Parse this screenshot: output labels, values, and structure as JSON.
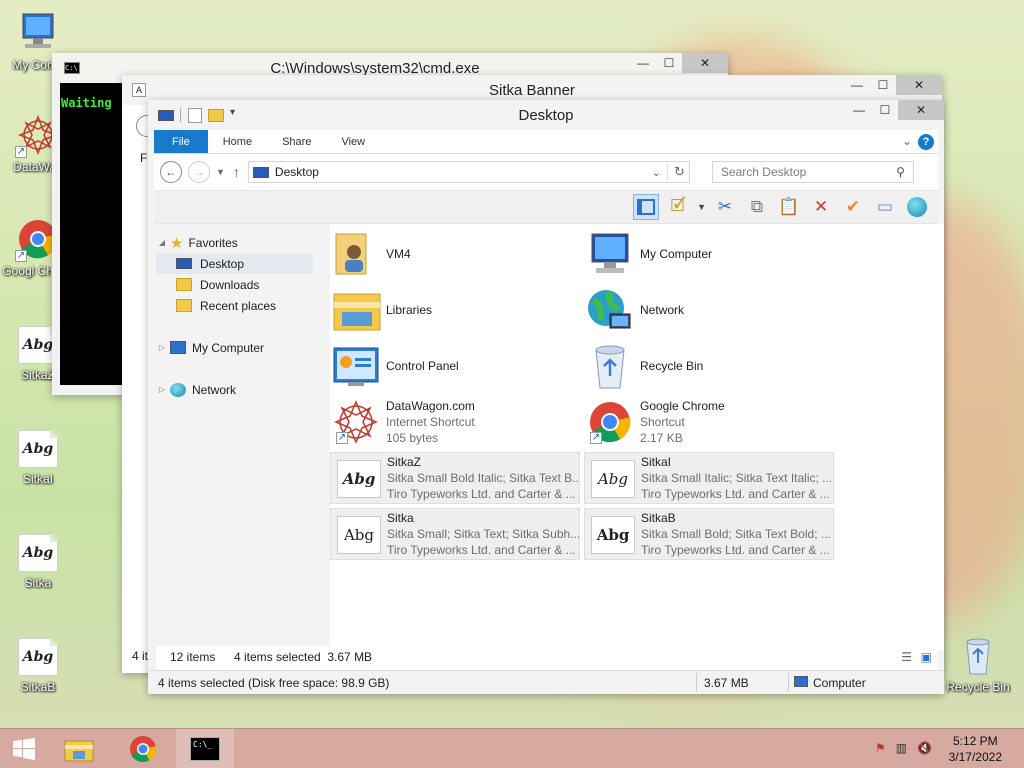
{
  "desktop": {
    "icons": [
      {
        "label": "My Comp",
        "icon": "computer-icon"
      },
      {
        "label": "DataWag",
        "icon": "datawagon-icon"
      },
      {
        "label": "Googl Chrom",
        "icon": "chrome-icon"
      },
      {
        "label": "SitkaZ",
        "icon": "font-icon",
        "glyph": "Abg"
      },
      {
        "label": "SitkaI",
        "icon": "font-icon",
        "glyph": "Abg"
      },
      {
        "label": "Sitka",
        "icon": "font-icon",
        "glyph": "Abg"
      },
      {
        "label": "SitkaB",
        "icon": "font-icon",
        "glyph": "Abg"
      }
    ],
    "recycle_bin_label": "Recycle Bin"
  },
  "cmd_window": {
    "title": "C:\\Windows\\system32\\cmd.exe",
    "text": "Waiting",
    "text_color": "#3cf03c"
  },
  "banner_window": {
    "title": "Sitka Banner",
    "partial_menu": "Fi",
    "partial_status": "4 it"
  },
  "explorer": {
    "title": "Desktop",
    "tabs": [
      "File",
      "Home",
      "Share",
      "View"
    ],
    "address": "Desktop",
    "search_placeholder": "Search Desktop",
    "nav": {
      "favorites": "Favorites",
      "desktop": "Desktop",
      "downloads": "Downloads",
      "recent": "Recent places",
      "computer": "My Computer",
      "network": "Network"
    },
    "items": [
      {
        "name": "VM4",
        "lines": []
      },
      {
        "name": "My Computer",
        "lines": []
      },
      {
        "name": "Libraries",
        "lines": []
      },
      {
        "name": "Network",
        "lines": []
      },
      {
        "name": "Control Panel",
        "lines": []
      },
      {
        "name": "Recycle Bin",
        "lines": []
      },
      {
        "name": "DataWagon.com",
        "lines": [
          "Internet Shortcut",
          "105 bytes"
        ]
      },
      {
        "name": "Google Chrome",
        "lines": [
          "Shortcut",
          "2.17 KB"
        ]
      },
      {
        "name": "SitkaZ",
        "lines": [
          "Sitka Small Bold Italic; Sitka Text B...",
          "Tiro Typeworks Ltd. and Carter & ..."
        ]
      },
      {
        "name": "SitkaI",
        "lines": [
          "Sitka Small Italic; Sitka Text Italic; ...",
          "Tiro Typeworks Ltd. and Carter & ..."
        ]
      },
      {
        "name": "Sitka",
        "lines": [
          "Sitka Small; Sitka Text; Sitka Subh...",
          "Tiro Typeworks Ltd. and Carter & ..."
        ]
      },
      {
        "name": "SitkaB",
        "lines": [
          "Sitka Small Bold; Sitka Text Bold; ...",
          "Tiro Typeworks Ltd. and Carter & ..."
        ]
      }
    ],
    "items_count": "12 items",
    "selected_info": "4 items selected  3.67 MB",
    "status_left": "4 items selected (Disk free space: 98.9 GB)",
    "status_size": "3.67 MB",
    "status_location": "Computer"
  },
  "taskbar": {
    "time": "5:12 PM",
    "date": "3/17/2022"
  },
  "colors": {
    "accent": "#1979ca",
    "taskbar": "#d6a9a1"
  }
}
